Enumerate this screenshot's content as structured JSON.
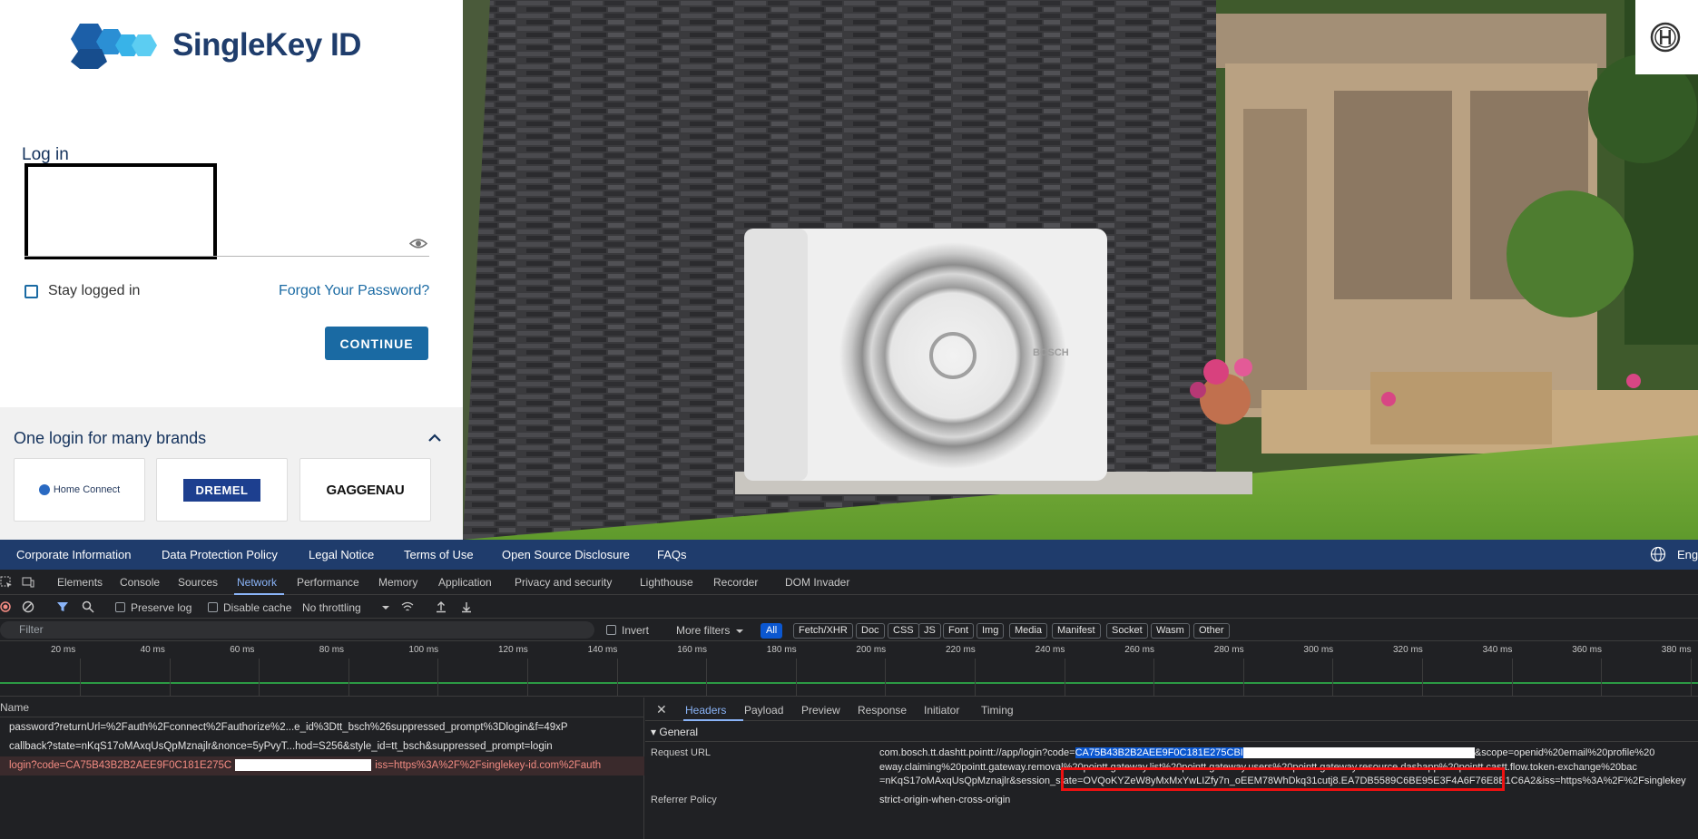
{
  "login": {
    "brand_name": "SingleKey ID",
    "title": "Log in",
    "stay_logged_in": "Stay logged in",
    "forgot_password": "Forgot Your Password?",
    "continue": "CONTINUE"
  },
  "brands": {
    "title": "One login for many brands",
    "items": [
      {
        "name": "Home Connect"
      },
      {
        "name": "DREMEL"
      },
      {
        "name": "GAGGENAU"
      }
    ]
  },
  "hero": {
    "unit_badge": "BOSCH"
  },
  "footer": {
    "links": [
      "Corporate Information",
      "Data Protection Policy",
      "Legal Notice",
      "Terms of Use",
      "Open Source Disclosure",
      "FAQs"
    ],
    "language": "Engl"
  },
  "devtools": {
    "tabs": [
      "Elements",
      "Console",
      "Sources",
      "Network",
      "Performance",
      "Memory",
      "Application",
      "Privacy and security",
      "Lighthouse",
      "Recorder",
      "DOM Invader"
    ],
    "active_tab": "Network",
    "toolbar": {
      "preserve_log": "Preserve log",
      "disable_cache": "Disable cache",
      "throttling": "No throttling"
    },
    "filter": {
      "placeholder": "Filter",
      "invert": "Invert",
      "more_filters": "More filters",
      "types": [
        "All",
        "Fetch/XHR",
        "Doc",
        "CSS",
        "JS",
        "Font",
        "Img",
        "Media",
        "Manifest",
        "Socket",
        "Wasm",
        "Other"
      ]
    },
    "timeline_labels": [
      "20 ms",
      "40 ms",
      "60 ms",
      "80 ms",
      "100 ms",
      "120 ms",
      "140 ms",
      "160 ms",
      "180 ms",
      "200 ms",
      "220 ms",
      "240 ms",
      "260 ms",
      "280 ms",
      "300 ms",
      "320 ms",
      "340 ms",
      "360 ms",
      "380 ms"
    ],
    "requests_header": "Name",
    "requests": [
      {
        "name": "password?returnUrl=%2Fauth%2Fconnect%2Fauthorize%2...e_id%3Dtt_bsch%26suppressed_prompt%3Dlogin&f=49xP"
      },
      {
        "name": "callback?state=nKqS17oMAxqUsQpMznajlr&nonce=5yPvyT...hod=S256&style_id=tt_bsch&suppressed_prompt=login"
      },
      {
        "name_prefix": "login?code=CA75B43B2B2AEE9F0C181E275C",
        "name_suffix": "iss=https%3A%2F%2Fsinglekey-id.com%2Fauth"
      }
    ],
    "details": {
      "tabs": [
        "Headers",
        "Payload",
        "Preview",
        "Response",
        "Initiator",
        "Timing"
      ],
      "active_tab": "Headers",
      "section": "General",
      "request_url_label": "Request URL",
      "request_url_prefix": "com.bosch.tt.dashtt.pointt://app/login",
      "request_url_code_key": "?code=",
      "request_url_code": "CA75B43B2B2AEE9F0C181E275CBI",
      "request_url_tail": "&scope=openid%20email%20profile%20",
      "request_url_line2": "eway.claiming%20pointt.gateway.removal%20pointt.gateway.list%20pointt.gateway.users%20pointt.gateway.resource.dashapp%20pointt.castt.flow.token-exchange%20bac",
      "request_url_line3": "=nKqS17oMAxqUsQpMznajlr&session_state=OVQoKYZeW8yMxMxYwLIZfy7n_oEEM78WhDkq31cutj8.EA7DB5589C6BE95E3F4A6F76E8E1C6A2&iss=https%3A%2F%2Fsinglekey",
      "referrer_label": "Referrer Policy",
      "referrer_value": "strict-origin-when-cross-origin"
    }
  }
}
